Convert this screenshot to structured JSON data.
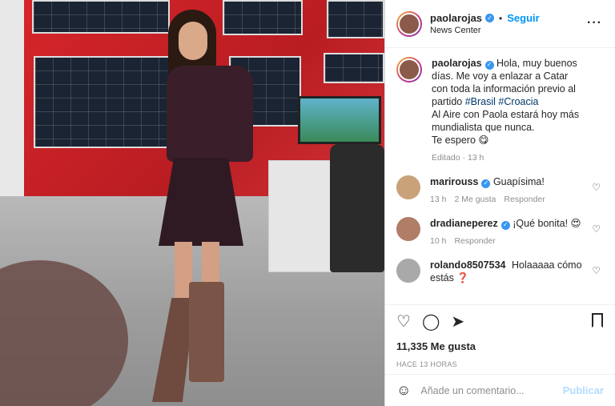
{
  "post": {
    "username": "paolarojas",
    "follow_label": "Seguir",
    "location": "News Center",
    "more_icon": "more-horizontal-icon"
  },
  "caption": {
    "username": "paolarojas",
    "text_1": "Hola, muy buenos días. Me voy a enlazar a Catar con toda la información previo al partido",
    "hashtag_1": "#Brasil",
    "hashtag_2": "#Croacia",
    "text_2": "Al Aire con Paola estará hoy más mundialista que nunca.",
    "text_3": "Te espero 😋",
    "meta": "Editado · 13 h"
  },
  "comments": [
    {
      "username": "marirouss",
      "verified": true,
      "text": "Guapísima!",
      "time": "13 h",
      "likes": "2 Me gusta",
      "reply": "Responder"
    },
    {
      "username": "dradianeperez",
      "verified": true,
      "text": "¡Qué bonita! 😍",
      "time": "10 h",
      "reply": "Responder"
    },
    {
      "username": "rolando8507534",
      "verified": false,
      "text": "Holaaaaa cómo estás ❓"
    }
  ],
  "actions": {
    "likes_count": "11,335 Me gusta",
    "timestamp": "HACE 13 HORAS"
  },
  "add_comment": {
    "placeholder": "Añade un comentario...",
    "post_label": "Publicar"
  },
  "colors": {
    "accent": "#0095f6",
    "hashtag": "#00376b",
    "muted": "#8e8e8e",
    "disabled_post": "#b3dbff"
  }
}
